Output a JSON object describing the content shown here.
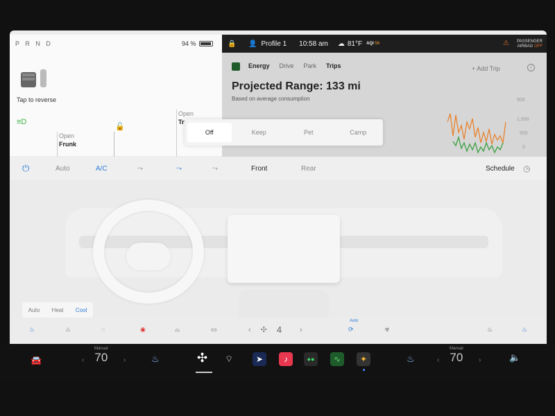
{
  "car": {
    "gear": "P R N D",
    "battery_text": "94 %",
    "battery_level_pct": 94,
    "tap_reverse": "Tap to reverse",
    "frunk_top": "Open",
    "frunk_bottom": "Frunk",
    "trunk_top": "Open",
    "trunk_bottom": "Trunk"
  },
  "status": {
    "profile": "Profile 1",
    "time": "10:58 am",
    "temp": "81°F",
    "aqi_label": "AQI",
    "aqi_value": "56",
    "airbag_line1": "PASSENGER",
    "airbag_line2": "AIRBAG",
    "airbag_state": "OFF"
  },
  "energy": {
    "tabs": [
      "Energy",
      "Drive",
      "Park",
      "Trips"
    ],
    "add_trip": "+ Add Trip",
    "range": "Projected Range: 133 mi",
    "subtitle": "Based on average consumption",
    "chart_ticks": [
      "500",
      "1,000",
      "500",
      "0"
    ]
  },
  "modes": {
    "items": [
      "Off",
      "Keep",
      "Pet",
      "Camp"
    ],
    "selected": "Off"
  },
  "climate": {
    "auto": "Auto",
    "ac": "A/C",
    "front": "Front",
    "rear": "Rear",
    "schedule": "Schedule"
  },
  "seat_mode": {
    "auto": "Auto",
    "heat": "Heat",
    "cool": "Cool"
  },
  "fan": {
    "speed": "4",
    "auto_label": "Auto"
  },
  "taskbar": {
    "left_temp_label": "Manual",
    "left_temp": "70",
    "right_temp_label": "Manual",
    "right_temp": "70"
  },
  "colors": {
    "accent_blue": "#2b7bd6",
    "energy_green": "#1f5c2c",
    "warning_orange": "#e07030"
  }
}
